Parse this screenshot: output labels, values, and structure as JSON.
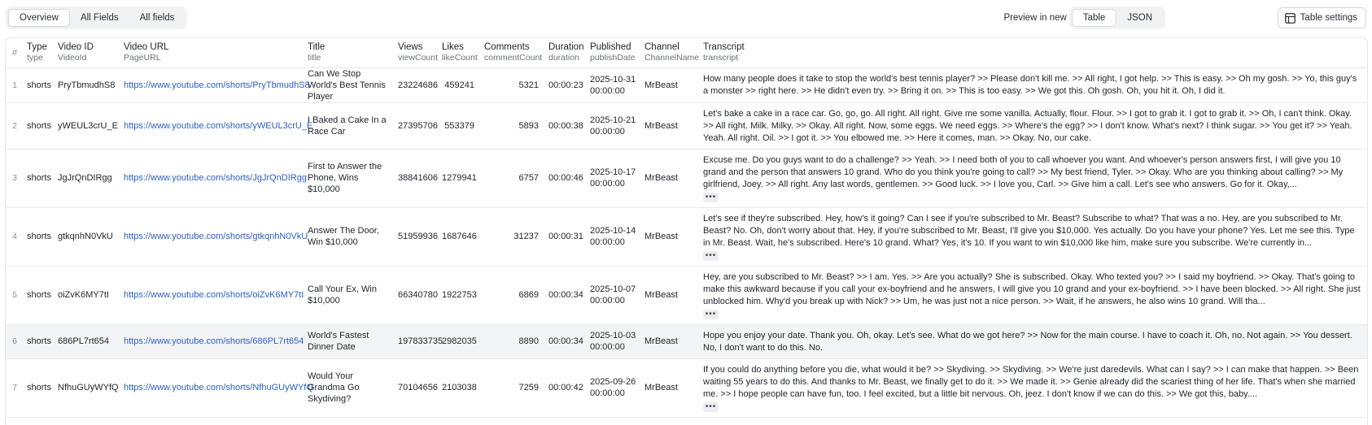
{
  "toolbar": {
    "tabs": [
      {
        "label": "Overview",
        "active": true
      },
      {
        "label": "All Fields",
        "active": false
      },
      {
        "label": "All fields",
        "active": false
      }
    ],
    "preview_label": "Preview in new tab",
    "formats": [
      {
        "label": "Table",
        "active": true
      },
      {
        "label": "JSON",
        "active": false
      }
    ],
    "settings_label": "Table settings",
    "settings_icon": "table-icon"
  },
  "table": {
    "index_header": "#",
    "columns": [
      {
        "label": "Type",
        "field": "type"
      },
      {
        "label": "Video ID",
        "field": "VideoId"
      },
      {
        "label": "Video URL",
        "field": "PageURL"
      },
      {
        "label": "Title",
        "field": "title"
      },
      {
        "label": "Views",
        "field": "viewCount"
      },
      {
        "label": "Likes",
        "field": "likeCount"
      },
      {
        "label": "Comments",
        "field": "commentCount"
      },
      {
        "label": "Duration",
        "field": "duration"
      },
      {
        "label": "Published",
        "field": "publishDate"
      },
      {
        "label": "Channel",
        "field": "ChannelName"
      },
      {
        "label": "Transcript",
        "field": "transcript"
      }
    ],
    "more_label": "•••",
    "rows": [
      {
        "idx": "1",
        "type": "shorts",
        "video_id": "PryTbmudhS8",
        "url": "https://www.youtube.com/shorts/PryTbmudhS8",
        "title": "Can We Stop World's Best Tennis Player",
        "views": "23224686",
        "likes": "459241",
        "comments": "5321",
        "duration": "00:00:23",
        "published_date": "2025-10-31",
        "published_time": "00:00:00",
        "channel": "MrBeast",
        "transcript": "How many people does it take to stop the world's best tennis player? >> Please don't kill me. >> All right, I got help. >> This is easy. >> Oh my gosh. >> Yo, this guy's a monster >> right here. >> He didn't even try. >> Bring it on. >> This is too easy. >> We got this. Oh gosh. Oh, you hit it. Oh, I did it.",
        "more": false,
        "highlight": false
      },
      {
        "idx": "2",
        "type": "shorts",
        "video_id": "yWEUL3crU_E",
        "url": "https://www.youtube.com/shorts/yWEUL3crU_E",
        "title": "I Baked a Cake In a Race Car",
        "views": "27395706",
        "likes": "553379",
        "comments": "5893",
        "duration": "00:00:38",
        "published_date": "2025-10-21",
        "published_time": "00:00:00",
        "channel": "MrBeast",
        "transcript": "Let's bake a cake in a race car. Go, go, go. All right. All right. Give me some vanilla. Actually, flour. Flour. >> I got to grab it. I got to grab it. >> Oh, I can't think. Okay. >> All right. Milk. Milky. >> Okay. All right. Now, some eggs. We need eggs. >> Where's the egg? >> I don't know. What's next? I think sugar. >> You get it? >> Yeah. Yeah. All right. Oil. >> I got it. >> You elbowed me. >> Here it comes, man. >> Okay. No, our cake.",
        "more": false,
        "highlight": false
      },
      {
        "idx": "3",
        "type": "shorts",
        "video_id": "JgJrQnDIRgg",
        "url": "https://www.youtube.com/shorts/JgJrQnDIRgg",
        "title": "First to Answer the Phone, Wins $10,000",
        "views": "38841606",
        "likes": "1279941",
        "comments": "6757",
        "duration": "00:00:46",
        "published_date": "2025-10-17",
        "published_time": "00:00:00",
        "channel": "MrBeast",
        "transcript": "Excuse me. Do you guys want to do a challenge? >> Yeah. >> I need both of you to call whoever you want. And whoever's person answers first, I will give you 10 grand and the person that answers 10 grand. Who do you think you're going to call? >> My best friend, Tyler. >> Okay. Who are you thinking about calling? >> My girlfriend, Joey. >> All right. Any last words, gentlemen. >> Good luck. >> I love you, Carl. >> Give him a call. Let's see who answers. Go for it. Okay,...",
        "more": true,
        "highlight": false
      },
      {
        "idx": "4",
        "type": "shorts",
        "video_id": "gtkqnhN0VkU",
        "url": "https://www.youtube.com/shorts/gtkqnhN0VkU",
        "title": "Answer The Door, Win $10,000",
        "views": "51959936",
        "likes": "1687646",
        "comments": "31237",
        "duration": "00:00:31",
        "published_date": "2025-10-14",
        "published_time": "00:00:00",
        "channel": "MrBeast",
        "transcript": "Let's see if they're subscribed. Hey, how's it going? Can I see if you're subscribed to Mr. Beast? Subscribe to what? That was a no. Hey, are you subscribed to Mr. Beast? No. Oh, don't worry about that. Hey, if you're subscribed to Mr. Beast, I'll give you $10,000. Yes actually. Do you have your phone? Yes. Let me see this. Type in Mr. Beast. Wait, he's subscribed. Here's 10 grand. What? Yes, it's 10. If you want to win $10,000 like him, make sure you subscribe. We're currently in...",
        "more": true,
        "highlight": false
      },
      {
        "idx": "5",
        "type": "shorts",
        "video_id": "oiZvK6MY7tI",
        "url": "https://www.youtube.com/shorts/oiZvK6MY7tI",
        "title": "Call Your Ex, Win $10,000",
        "views": "66340780",
        "likes": "1922753",
        "comments": "6869",
        "duration": "00:00:34",
        "published_date": "2025-10-07",
        "published_time": "00:00:00",
        "channel": "MrBeast",
        "transcript": "Hey, are you subscribed to Mr. Beast? >> I am. Yes. >> Are you actually? She is subscribed. Okay. Who texted you? >> I said my boyfriend. >> Okay. That's going to make this awkward because if you call your ex-boyfriend and he answers, I will give you 10 grand and your ex-boyfriend. >> I have been blocked. >> All right. She just unblocked him. Why'd you break up with Nick? >> Um, he was just not a nice person. >> Wait, if he answers, he also wins 10 grand. Will tha...",
        "more": true,
        "highlight": false
      },
      {
        "idx": "6",
        "type": "shorts",
        "video_id": "686PL7rt654",
        "url": "https://www.youtube.com/shorts/686PL7rt654",
        "title": "World's Fastest Dinner Date",
        "views": "197833735",
        "likes": "2982035",
        "comments": "8890",
        "duration": "00:00:34",
        "published_date": "2025-10-03",
        "published_time": "00:00:00",
        "channel": "MrBeast",
        "transcript": "Hope you enjoy your date. Thank you. Oh, okay. Let's see. What do we got here? >> Now for the main course. I have to coach it. Oh, no. Not again. >> You dessert. No, I don't want to do this. No.",
        "more": false,
        "highlight": true
      },
      {
        "idx": "7",
        "type": "shorts",
        "video_id": "NfhuGUyWYfQ",
        "url": "https://www.youtube.com/shorts/NfhuGUyWYfQ",
        "title": "Would Your Grandma Go Skydiving?",
        "views": "70104656",
        "likes": "2103038",
        "comments": "7259",
        "duration": "00:00:42",
        "published_date": "2025-09-26",
        "published_time": "00:00:00",
        "channel": "MrBeast",
        "transcript": "If you could do anything before you die, what would it be? >> Skydiving. >> Skydiving. >> We're just daredevils. What can I say? >> I can make that happen. >> Been waiting 55 years to do this. And thanks to Mr. Beast, we finally get to do it. >> We made it. >> Genie already did the scariest thing of her life. That's when she married me. >> I hope people can have fun, too. I feel excited, but a little bit nervous. Oh, jeez. I don't know if we can do this. >> We got this, baby....",
        "more": true,
        "highlight": false
      }
    ]
  }
}
